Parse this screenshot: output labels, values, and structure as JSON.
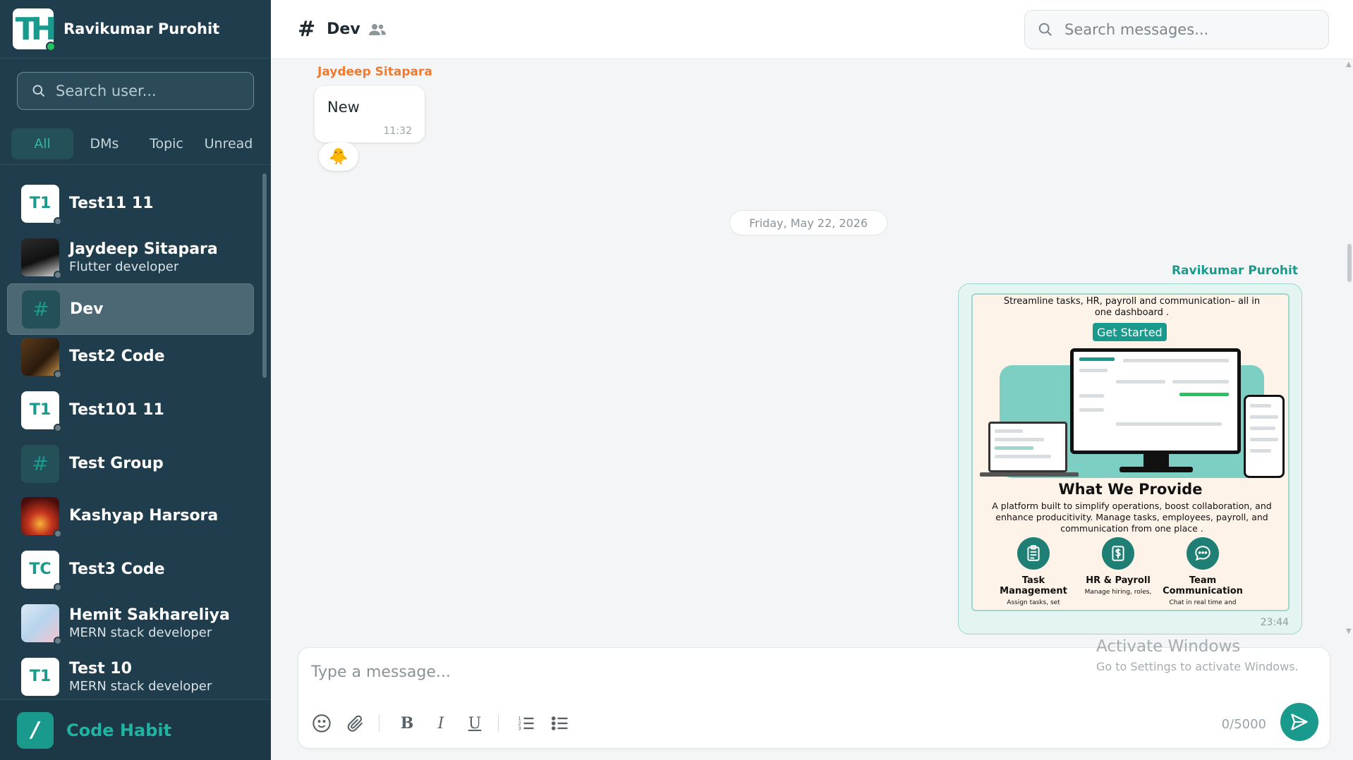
{
  "user": {
    "name": "Ravikumar Purohit"
  },
  "sidebar": {
    "search_placeholder": "Search user...",
    "filters": [
      "All",
      "DMs",
      "Topic",
      "Unread"
    ],
    "chats": [
      {
        "name": "Test11 11",
        "initials": "T1",
        "subtitle": ""
      },
      {
        "name": "Jaydeep Sitapara",
        "initials": "",
        "subtitle": "Flutter developer"
      },
      {
        "name": "Dev",
        "initials": "#",
        "subtitle": ""
      },
      {
        "name": "Test2 Code",
        "initials": "",
        "subtitle": ""
      },
      {
        "name": "Test101 11",
        "initials": "T1",
        "subtitle": ""
      },
      {
        "name": "Test Group",
        "initials": "#",
        "subtitle": ""
      },
      {
        "name": "Kashyap Harsora",
        "initials": "",
        "subtitle": ""
      },
      {
        "name": "Test3 Code",
        "initials": "TC",
        "subtitle": ""
      },
      {
        "name": "Hemit Sakhareliya",
        "initials": "",
        "subtitle": "MERN stack developer"
      },
      {
        "name": "Test 10",
        "initials": "T1",
        "subtitle": "MERN stack developer"
      }
    ],
    "brand": "Code Habit"
  },
  "channel": {
    "hash": "#",
    "name": "Dev",
    "search_placeholder": "Search messages..."
  },
  "messages": {
    "first": {
      "sender": "Jaydeep Sitapara",
      "text": "New",
      "time": "11:32",
      "reaction": "🐥"
    },
    "date_divider": "Friday, May 22, 2026",
    "second": {
      "sender": "Ravikumar Purohit",
      "time": "23:44",
      "promo": {
        "tagline": "Streamline tasks, HR, payroll and communication– all in one dashboard .",
        "cta": "Get Started",
        "heading": "What We Provide",
        "description": "A platform built to simplify operations, boost collaboration, and enhance producitivity. Manage tasks, employees, payroll, and communication from one place .",
        "features": [
          {
            "title": "Task Management",
            "sub": "Assign tasks, set"
          },
          {
            "title": "HR & Payroll",
            "sub": "Manage hiring, roles,"
          },
          {
            "title": "Team Communication",
            "sub": "Chat in real time and"
          }
        ]
      }
    }
  },
  "composer": {
    "placeholder": "Type a message...",
    "counter": "0/5000",
    "bold": "B",
    "italic": "I",
    "underline": "U"
  },
  "watermark": {
    "line1": "Activate Windows",
    "line2": "Go to Settings to activate Windows."
  },
  "colors": {
    "sidebar_bg": "#1f3d4c",
    "accent": "#1a9a8c",
    "sender_orange": "#f07a2e"
  }
}
